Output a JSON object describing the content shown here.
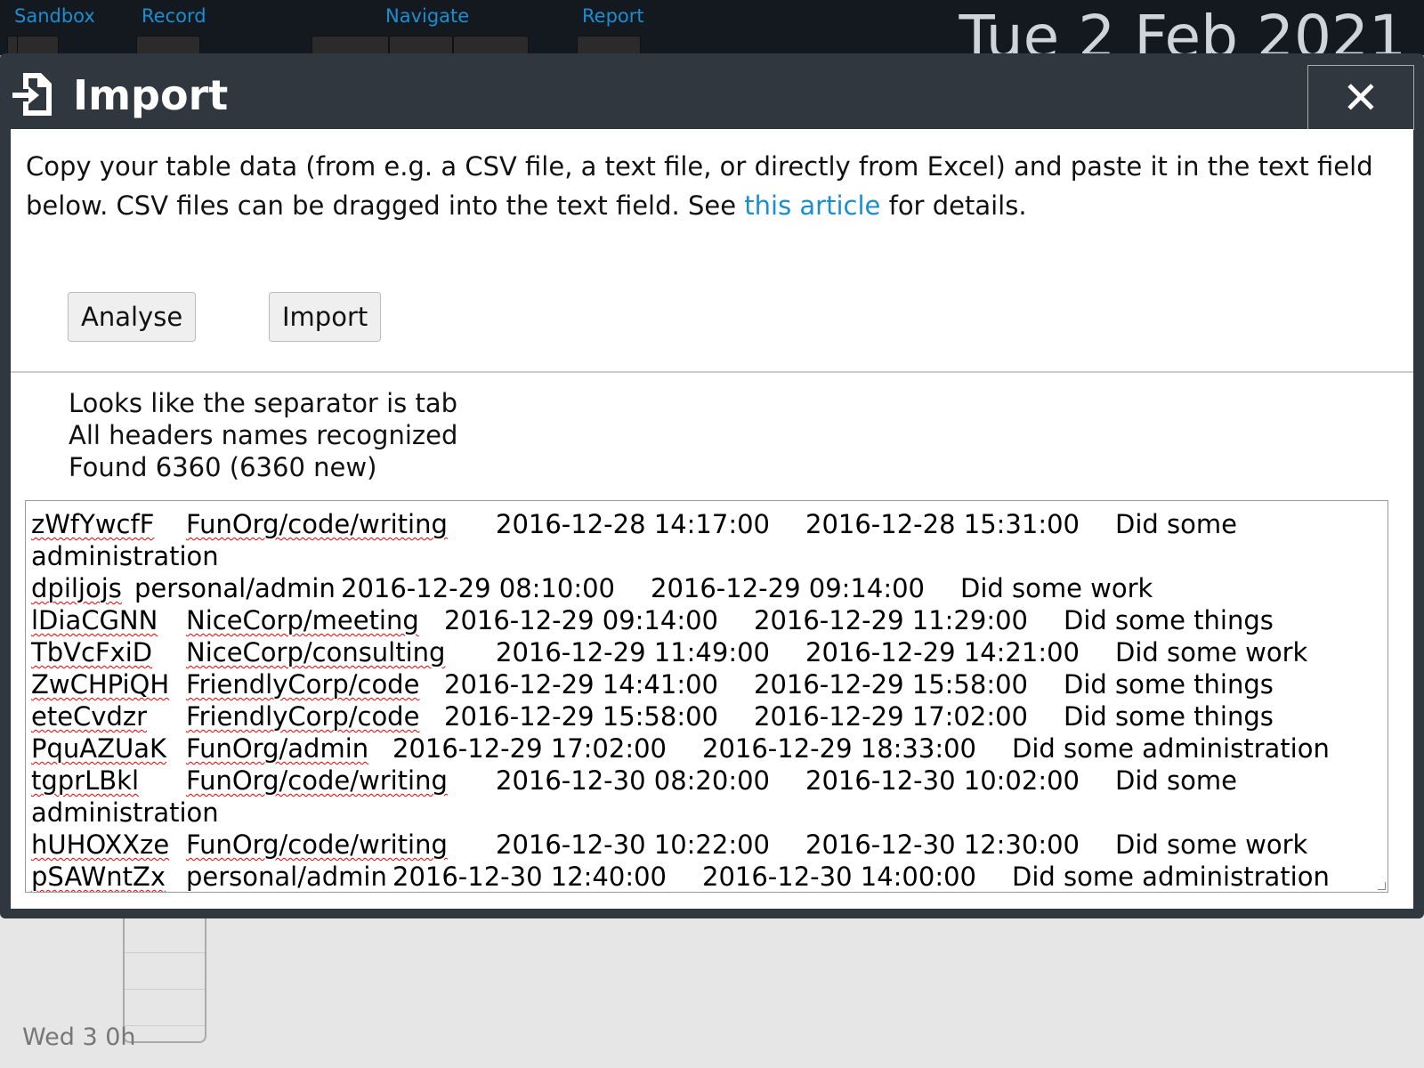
{
  "topbar": {
    "menus": [
      "Sandbox",
      "Record",
      "Navigate",
      "Report"
    ],
    "date": "Tue  2 Feb 2021"
  },
  "background": {
    "day_label": "Wed 3 0h"
  },
  "dialog": {
    "title": "Import",
    "icon": "file-import-icon",
    "close_icon": "close-icon",
    "intro_before": "Copy your table data (from e.g. a CSV file, a text file, or directly from Excel) and paste it in the text field below. CSV files can be dragged into the text field. See ",
    "intro_link": "this article",
    "intro_after": " for details.",
    "analyse_label": "Analyse",
    "import_label": "Import",
    "status": [
      "Looks like the separator is tab",
      "All headers names recognized",
      "Found 6360 (6360 new)"
    ],
    "rows": [
      [
        "zWfYwcfF",
        "FunOrg/code/writing",
        "2016-12-28 14:17:00",
        "2016-12-28 15:31:00",
        "Did some administration"
      ],
      [
        "dpiljojs",
        "personal/admin",
        "2016-12-29 08:10:00",
        "2016-12-29 09:14:00",
        "Did some work"
      ],
      [
        "lDiaCGNN",
        "NiceCorp/meeting",
        "2016-12-29 09:14:00",
        "2016-12-29 11:29:00",
        "Did some things"
      ],
      [
        "TbVcFxiD",
        "NiceCorp/consulting",
        "2016-12-29 11:49:00",
        "2016-12-29 14:21:00",
        "Did some work"
      ],
      [
        "ZwCHPiQH",
        "FriendlyCorp/code",
        "2016-12-29 14:41:00",
        "2016-12-29 15:58:00",
        "Did some things"
      ],
      [
        "eteCvdzr",
        "FriendlyCorp/code",
        "2016-12-29 15:58:00",
        "2016-12-29 17:02:00",
        "Did some things"
      ],
      [
        "PquAZUaK",
        "FunOrg/admin",
        "2016-12-29 17:02:00",
        "2016-12-29 18:33:00",
        "Did some administration"
      ],
      [
        "tgprLBkl",
        "FunOrg/code/writing",
        "2016-12-30 08:20:00",
        "2016-12-30 10:02:00",
        "Did some administration"
      ],
      [
        "hUHOXXze",
        "FunOrg/code/writing",
        "2016-12-30 10:22:00",
        "2016-12-30 12:30:00",
        "Did some work"
      ],
      [
        "pSAWntZx",
        "personal/admin",
        "2016-12-30 12:40:00",
        "2016-12-30 14:00:00",
        "Did some administration"
      ]
    ]
  },
  "colors": {
    "accent": "#1a8ed0",
    "header": "#30373f",
    "topbar": "#141920"
  }
}
